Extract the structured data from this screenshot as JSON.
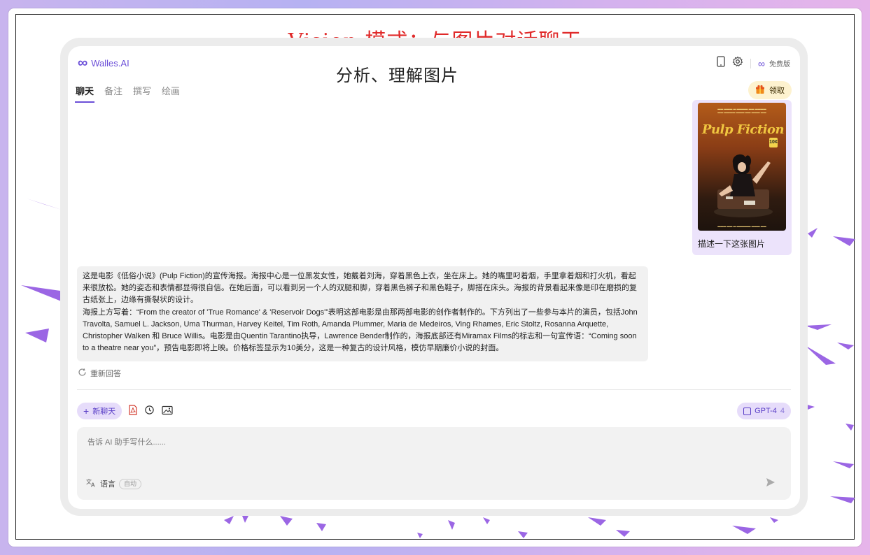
{
  "caption": {
    "title": "Vision 模式：与图片对话聊天",
    "subtitle": "分析、理解图片"
  },
  "header": {
    "logo_icon": "∞",
    "logo_text": "Walles.AI",
    "icons": [
      "phone-icon",
      "gear-icon"
    ],
    "plan_icon": "∞",
    "plan_label": "免费版",
    "claim_label": "领取",
    "claim_icon": "gift-icon"
  },
  "tabs": [
    {
      "label": "聊天",
      "active": true
    },
    {
      "label": "备注",
      "active": false
    },
    {
      "label": "撰写",
      "active": false
    },
    {
      "label": "绘画",
      "active": false
    }
  ],
  "user_message": {
    "text": "描述一下这张图片",
    "poster_title": "Pulp Fiction",
    "poster_price": "10¢"
  },
  "ai_message": {
    "paragraph1": "这是电影《低俗小说》(Pulp Fiction)的宣传海报。海报中心是一位黑发女性，她戴着刘海，穿着黑色上衣，坐在床上。她的嘴里叼着烟，手里拿着烟和打火机，看起来很放松。她的姿态和表情都显得很自信。在她后面，可以看到另一个人的双腿和脚，穿着黑色裤子和黑色鞋子，脚搭在床头。海报的背景看起来像是印在磨损的复古纸张上，边缘有撕裂状的设计。",
    "paragraph2": "海报上方写着：“From the creator of 'True Romance' & 'Reservoir Dogs'”表明这部电影是由那两部电影的创作者制作的。下方列出了一些参与本片的演员，包括John Travolta, Samuel L. Jackson, Uma Thurman, Harvey Keitel, Tim Roth, Amanda Plummer, Maria de Medeiros, Ving Rhames, Eric Stoltz, Rosanna Arquette, Christopher Walken 和 Bruce Willis。电影是由Quentin Tarantino执导，Lawrence Bender制作的，海报底部还有Miramax Films的标志和一句宣传语：“Coming soon to a theatre near you”，预告电影即将上映。价格标签显示为10美分，这是一种复古的设计风格，模仿早期廉价小说的封面。"
  },
  "regenerate_label": "重新回答",
  "toolbar": {
    "new_chat_label": "新聊天",
    "new_chat_icon": "+",
    "icons": [
      "pdf-icon",
      "history-icon",
      "image-upload-icon"
    ]
  },
  "model": {
    "label": "GPT-4",
    "count": "4"
  },
  "input": {
    "placeholder": "告诉 AI 助手写什么......",
    "language_label": "语言",
    "language_value": "自动",
    "language_icon": "translate-icon",
    "send_icon": "send-icon"
  },
  "colors": {
    "accent": "#6b4fd8",
    "caption_red": "#e02a2a",
    "user_bubble": "#ece3fb",
    "ai_bubble": "#f1f1f1"
  }
}
